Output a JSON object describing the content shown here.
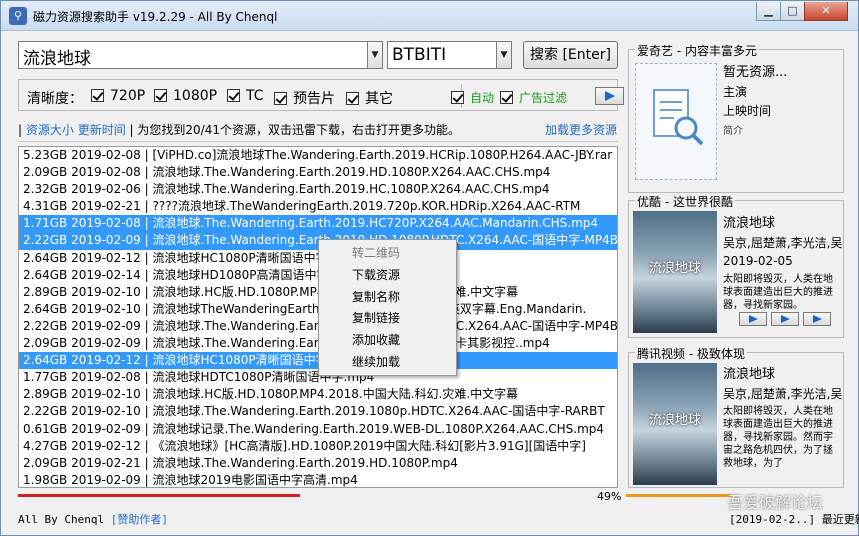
{
  "window": {
    "title": "磁力资源搜索助手 v19.2.29 - All By Chenql"
  },
  "search": {
    "query": "流浪地球",
    "engine": "BTBITI",
    "button_label": "搜索 [Enter]"
  },
  "filters": {
    "clarity_label": "清晰度：",
    "options": [
      "720P",
      "1080P",
      "TC",
      "预告片",
      "其它"
    ],
    "auto_label": "自动",
    "ad_filter_label": "广告过滤"
  },
  "info": {
    "sort_size": "资源大小",
    "sort_time": "更新时间",
    "status": "为您找到20/41个资源，双击迅雷下载，右击打开更多功能。",
    "load_more": "加载更多资源"
  },
  "results": [
    "5.23GB 2019-02-08 | [ViPHD.co]流浪地球The.Wandering.Earth.2019.HCRip.1080P.H264.AAC-JBY.rar",
    "2.09GB 2019-02-08 | 流浪地球.The.Wandering.Earth.2019.HD.1080P.X264.AAC.CHS.mp4",
    "2.32GB 2019-02-06 | 流浪地球.The.Wandering.Earth.2019.HC.1080P.X264.AAC.CHS.mp4",
    "4.31GB 2019-02-21 | ????流浪地球.TheWanderingEarth.2019.720p.KOR.HDRip.X264.AAC-RTM",
    "1.71GB 2019-02-08 | 流浪地球.The.Wandering.Earth.2019.HC720P.X264.AAC.Mandarin.CHS.mp4",
    "2.22GB 2019-02-09 | 流浪地球.The.Wandering.Earth.2019.HD.1080P.HDTC.X264.AAC-国语中字-MP4BA",
    "2.64GB 2019-02-12 | 流浪地球HC1080P清晰国语中字.mp4",
    "2.64GB 2019-02-14 | 流浪地球HD1080P高清国语中字.mp4",
    "2.89GB 2019-02-10 | 流浪地球.HC版.HD.1080P.MP4.2018.中国大陆.科幻.灾难.中文字幕",
    "2.64GB 2019-02-10 | 流浪地球TheWanderingEarth2019.HD1080P.国语中英双字幕.Eng.Mandarin.",
    "2.22GB 2019-02-09 | 流浪地球.The.Wandering.Earth.2019.HD.1080P.HDTC.X264.AAC-国语中字-MP4BA",
    "2.09GB 2019-02-09 | 流浪地球.The.Wandering.Earth.2019.HD1080P.关注:卡其影视控..mp4",
    "2.64GB 2019-02-12 | 流浪地球HC1080P清晰国语中字.mp4",
    "1.77GB 2019-02-08 | 流浪地球HDTC1080P清晰国语中字.mp4",
    "2.89GB 2019-02-10 | 流浪地球.HC版.HD.1080P.MP4.2018.中国大陆.科幻.灾难.中文字幕",
    "2.22GB 2019-02-10 | 流浪地球.The.Wandering.Earth.2019.1080p.HDTC.X264.AAC-国语中字-RARBT",
    "0.61GB 2019-02-09 | 流浪地球记录.The.Wandering.Earth.2019.WEB-DL.1080P.X264.AAC.CHS.mp4",
    "4.27GB 2019-02-12 | 《流浪地球》[HC高清版].HD.1080P.2019中国大陆.科幻[影片3.91G][国语中字]",
    "2.09GB 2019-02-21 | 流浪地球.The.Wandering.Earth.2019.HD.1080P.mp4",
    "1.98GB 2019-02-09 | 流浪地球2019电影国语中字高清.mp4"
  ],
  "context_menu": [
    "转二维码",
    "下载资源",
    "复制名称",
    "复制链接",
    "添加收藏",
    "继续加载"
  ],
  "progress": {
    "left_percent": 49,
    "left_label": "49%"
  },
  "statusbar": {
    "left": "All By Chenql",
    "sponsor": "[赞助作者]",
    "right": "[2019-02-2..] 最近更新"
  },
  "watermark": "吾爱破解论坛",
  "panels": {
    "iqiyi": {
      "title": "爱奇艺 - 内容丰富多元",
      "no_resource": "暂无资源...",
      "cast_label": "主演",
      "date_label": "上映时间",
      "desc_label": "简介"
    },
    "youku": {
      "title": "优酷 - 这世界很酷",
      "movie": "流浪地球",
      "cast": "吴京,屈楚萧,李光洁,吴",
      "date": "2019-02-05",
      "desc": "太阳即将毁灭，人类在地球表面建造出巨大的推进器，寻找新家园。"
    },
    "tencent": {
      "title": "腾讯视频 - 极致体现",
      "movie": "流浪地球",
      "cast": "吴京,屈楚萧,李光洁,吴",
      "desc": "太阳即将毁灭，人类在地球表面建造出巨大的推进器，寻找新家园。然而宇宙之路危机四伏，为了拯救地球，为了"
    },
    "poster_text": "流浪地球"
  },
  "colors": {
    "selection": "#3399ff",
    "link": "#1f6ac6",
    "progress_left": "#d62020",
    "progress_right": "#e8961e"
  }
}
